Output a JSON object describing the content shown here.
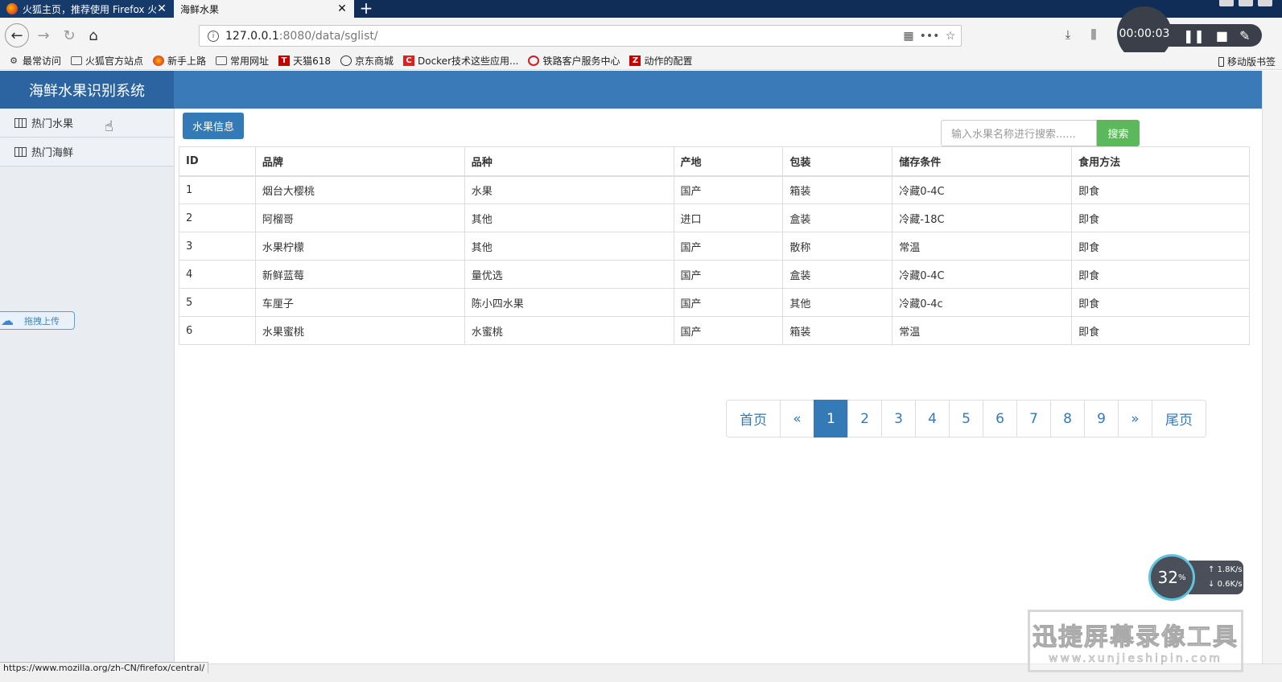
{
  "browser": {
    "tabs": [
      {
        "label": "火狐主页，推荐使用 Firefox 火"
      },
      {
        "label": "海鲜水果"
      }
    ],
    "url_host": "127.0.0.1",
    "url_rest": ":8080/data/sglist/",
    "recorder_time": "00:00:03",
    "bookmarks": [
      {
        "label": "最常访问",
        "icon": "gear-icon"
      },
      {
        "label": "火狐官方站点",
        "icon": "folder-icon"
      },
      {
        "label": "新手上路",
        "icon": "firefox-icon"
      },
      {
        "label": "常用网址",
        "icon": "folder-icon"
      },
      {
        "label": "天猫618",
        "icon": "tmall-icon"
      },
      {
        "label": "京东商城",
        "icon": "globe-icon"
      },
      {
        "label": "Docker技术这些应用...",
        "icon": "docker-icon"
      },
      {
        "label": "铁路客户服务中心",
        "icon": "railway-icon"
      },
      {
        "label": "动作的配置",
        "icon": "z-icon"
      }
    ],
    "mobile_bookmarks": "移动版书签",
    "status_url": "https://www.mozilla.org/zh-CN/firefox/central/"
  },
  "app": {
    "title": "海鲜水果识别系统",
    "sidebar": [
      {
        "label": "热门水果"
      },
      {
        "label": "热门海鲜"
      }
    ],
    "upload_label": "拖拽上传",
    "info_button": "水果信息",
    "search_placeholder": "输入水果名称进行搜索......",
    "search_button": "搜索"
  },
  "table": {
    "headers": [
      "ID",
      "品牌",
      "品种",
      "产地",
      "包装",
      "储存条件",
      "食用方法"
    ],
    "rows": [
      [
        "1",
        "烟台大樱桃",
        "水果",
        "国产",
        "箱装",
        "冷藏0-4C",
        "即食"
      ],
      [
        "2",
        "阿榴哥",
        "其他",
        "进口",
        "盒装",
        "冷藏-18C",
        "即食"
      ],
      [
        "3",
        "水果柠檬",
        "其他",
        "国产",
        "散称",
        "常温",
        "即食"
      ],
      [
        "4",
        "新鲜蓝莓",
        "量优选",
        "国产",
        "盒装",
        "冷藏0-4C",
        "即食"
      ],
      [
        "5",
        "车厘子",
        "陈小四水果",
        "国产",
        "其他",
        "冷藏0-4c",
        "即食"
      ],
      [
        "6",
        "水果蜜桃",
        "水蜜桃",
        "国产",
        "箱装",
        "常温",
        "即食"
      ]
    ]
  },
  "pagination": {
    "first": "首页",
    "prev": "«",
    "pages": [
      "1",
      "2",
      "3",
      "4",
      "5",
      "6",
      "7",
      "8",
      "9"
    ],
    "current": "1",
    "next": "»",
    "last": "尾页"
  },
  "overlay": {
    "net_percent": "32",
    "net_percent_unit": "%",
    "upload_rate": "1.8K/s",
    "download_rate": "0.6K/s",
    "watermark_title": "迅捷屏幕录像工具",
    "watermark_url": "www.xunjieshipin.com"
  }
}
